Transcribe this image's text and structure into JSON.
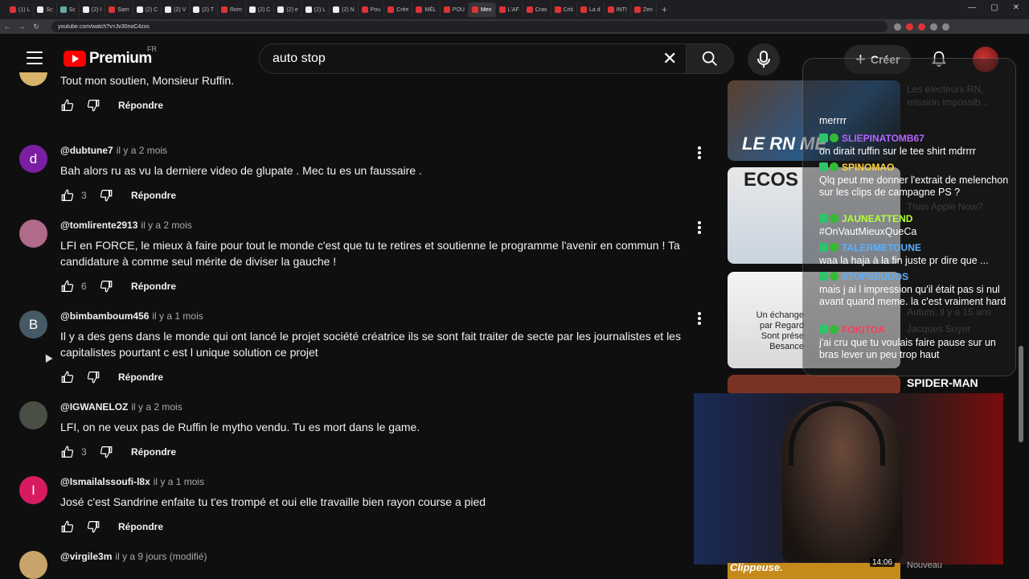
{
  "browser": {
    "tabs": [
      {
        "label": "(1) L",
        "icon": "youtube-icon"
      },
      {
        "label": "Sc",
        "icon": "x-icon"
      },
      {
        "label": "Sc",
        "icon": "generic-icon"
      },
      {
        "label": "(2) I",
        "icon": "x-icon"
      },
      {
        "label": "Sam",
        "icon": "youtube-icon"
      },
      {
        "label": "(2) C",
        "icon": "x-icon"
      },
      {
        "label": "(2) V",
        "icon": "x-icon"
      },
      {
        "label": "(2) T",
        "icon": "x-icon"
      },
      {
        "label": "Rom",
        "icon": "youtube-icon"
      },
      {
        "label": "(2) C",
        "icon": "x-icon"
      },
      {
        "label": "(2) e",
        "icon": "x-icon"
      },
      {
        "label": "(2) L",
        "icon": "x-icon"
      },
      {
        "label": "(2) N",
        "icon": "x-icon"
      },
      {
        "label": "Pou",
        "icon": "youtube-icon"
      },
      {
        "label": "Crée",
        "icon": "youtube-icon"
      },
      {
        "label": "MÉL",
        "icon": "youtube-icon"
      },
      {
        "label": "POU",
        "icon": "youtube-icon"
      },
      {
        "label": "Men",
        "icon": "youtube-icon",
        "active": true
      },
      {
        "label": "L'AF",
        "icon": "youtube-icon"
      },
      {
        "label": "Cras",
        "icon": "youtube-icon"
      },
      {
        "label": "Criti",
        "icon": "youtube-icon"
      },
      {
        "label": "La d",
        "icon": "youtube-icon"
      },
      {
        "label": "INTI",
        "icon": "youtube-icon"
      },
      {
        "label": "Zen",
        "icon": "youtube-icon"
      }
    ],
    "url": "youtube.com/watch?v=Jv30noC4zxs"
  },
  "header": {
    "logo_text": "Premium",
    "country": "FR",
    "search_value": "auto stop",
    "create_label": "Créer"
  },
  "comments": [
    {
      "author": "",
      "time": "",
      "text": "Tout mon soutien, Monsieur Ruffin.",
      "likes": "",
      "reply": "Répondre",
      "avatar_letter": "",
      "avatar_color": "#d8b46a"
    },
    {
      "author": "@dubtune7",
      "time": "il y a 2 mois",
      "text": "Bah alors ru as vu la derniere video de glupate . Mec tu es un faussaire .",
      "likes": "3",
      "reply": "Répondre",
      "avatar_letter": "d",
      "avatar_color": "#7b1fa2"
    },
    {
      "author": "@tomlirente2913",
      "time": "il y a 2 mois",
      "text": "LFI en FORCE, le mieux à faire pour tout le monde c'est que tu te retires et soutienne le programme l'avenir en commun ! Ta candidature à comme seul mérite de diviser la gauche !",
      "likes": "6",
      "reply": "Répondre",
      "avatar_letter": "",
      "avatar_color": "#b06a8a"
    },
    {
      "author": "@bimbamboum456",
      "time": "il y a 1 mois",
      "text": "Il y a des gens dans le monde qui ont lancé le projet société créatrice ils se sont fait traiter de secte par les journalistes et les capitalistes pourtant c est l unique solution ce projet",
      "likes": "",
      "reply": "Répondre",
      "avatar_letter": "B",
      "avatar_color": "#455a64"
    },
    {
      "author": "@IGWANELOZ",
      "time": "il y a 2 mois",
      "text": "LFI, on ne veux pas de Ruffin le mytho vendu. Tu es mort dans le game.",
      "likes": "3",
      "reply": "Répondre",
      "avatar_letter": "",
      "avatar_color": "#4a4f45"
    },
    {
      "author": "@Ismailalssoufi-l8x",
      "time": "il y a 1 mois",
      "text": "José c'est Sandrine enfaite tu t'es trompé et oui elle travaille bien rayon course a pied",
      "likes": "",
      "reply": "Répondre",
      "avatar_letter": "I",
      "avatar_color": "#d81b60"
    },
    {
      "author": "@virgile3m",
      "time": "il y a 9 jours (modifié)",
      "text": "",
      "likes": "",
      "reply": "",
      "avatar_letter": "",
      "avatar_color": "#c8a46a"
    }
  ],
  "sidebar": {
    "thumb1_label": "LE RN ME",
    "thumb2_label": "ECOS",
    "thumb3_text": "Un échange par Regard Sont prése Besance",
    "thumb4_title": "SPIDER-MAN",
    "bottom_label": "Clippeuse.",
    "duration": "14:06",
    "new_label": "Nouveau",
    "faded_meta": [
      "Les électeurs RN,",
      "mission impossib...",
      "Than Apple Now?",
      "Autum, il y a 15 ans",
      "Jacques Soyer"
    ]
  },
  "chat": [
    {
      "user": "",
      "text": "merrrr",
      "color": "#ff5a6a"
    },
    {
      "user": "SLIEPINATOMB67",
      "text": "on dirait ruffin sur le tee shirt mdrrrr",
      "color": "#b266ff"
    },
    {
      "user": "SPINOMAO",
      "text": "Qlq peut me donner l'extrait de melenchon sur les clips de campagne PS ?",
      "color": "#ffd23a"
    },
    {
      "user": "JAUNEATTEND",
      "text": "#OnVautMieuxQueCa",
      "color": "#b4ff3a"
    },
    {
      "user": "TALERMETOUNE",
      "text": "waa la haja à la fin juste pr dire que ...",
      "color": "#5ab0ff"
    },
    {
      "user": "STOPSEUDOS",
      "text": "mais j ai l impression qu'il était pas si nul avant quand meme. la c'est vraiment hard",
      "color": "#5ab0ff"
    },
    {
      "user": "FOKITOA",
      "text": "j'ai cru que tu voulais faire pause sur un bras lever un peu trop haut",
      "color": "#ff3a5a"
    }
  ]
}
